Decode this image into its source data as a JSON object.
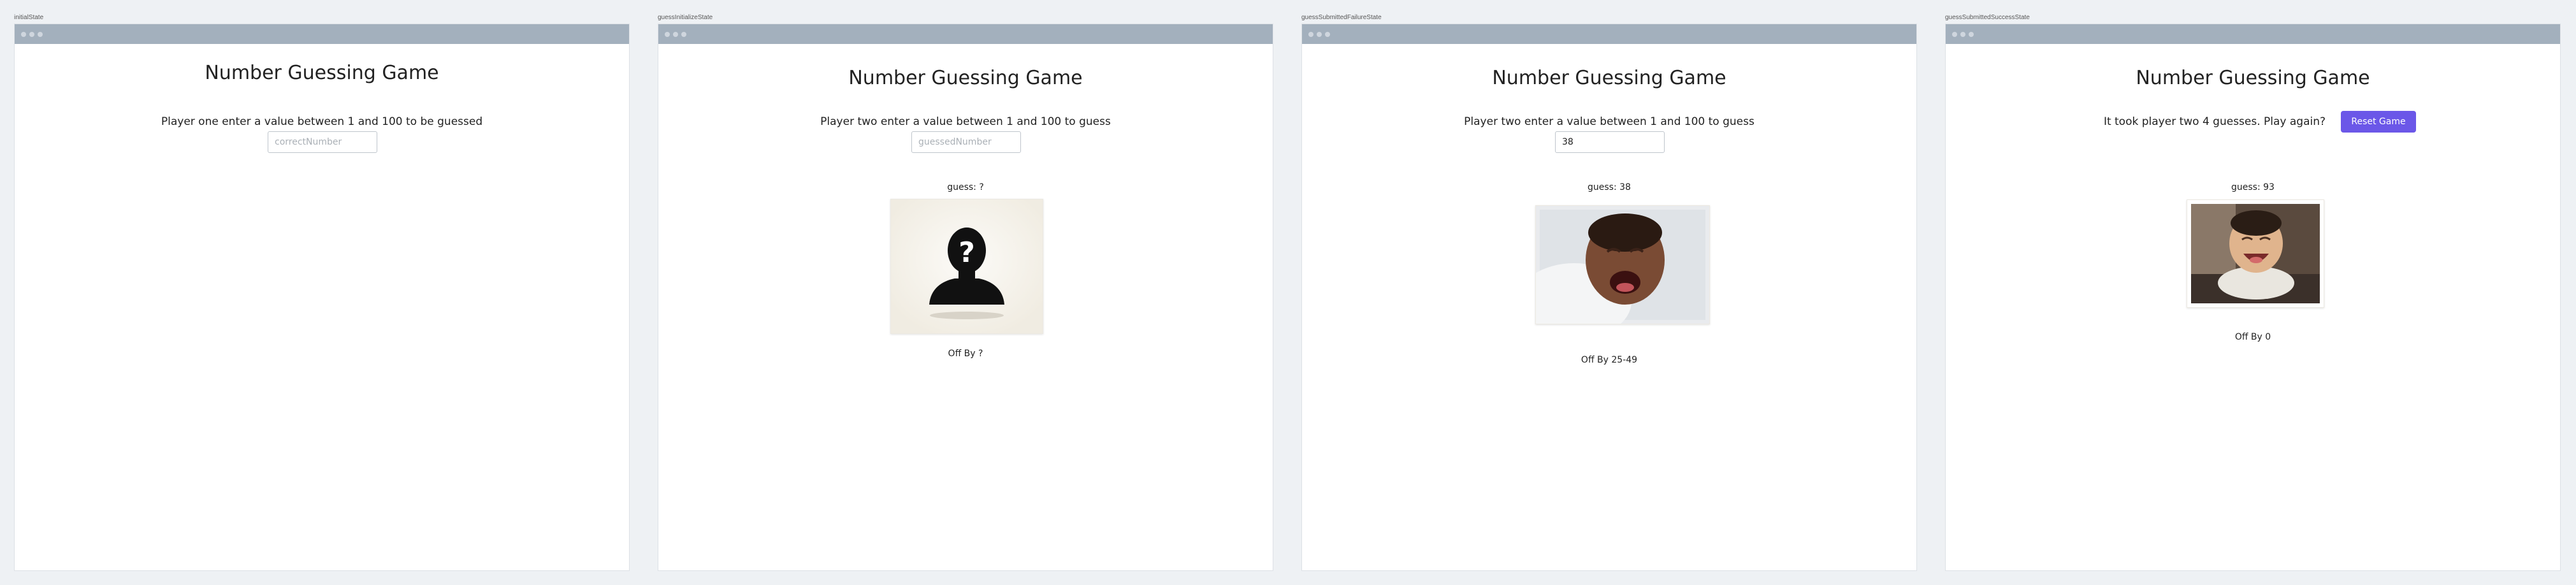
{
  "panels": [
    {
      "label": "initialState",
      "title": "Number Guessing Game",
      "prompt": "Player one enter a value between 1 and 100 to be guessed",
      "input": {
        "value": "",
        "placeholder": "correctNumber"
      }
    },
    {
      "label": "guessInitializeState",
      "title": "Number Guessing Game",
      "prompt": "Player two enter a value between 1 and 100 to guess",
      "input": {
        "value": "",
        "placeholder": "guessedNumber"
      },
      "guess": "guess: ?",
      "image": "mystery-silhouette",
      "off_by": "Off By ?"
    },
    {
      "label": "guessSubmittedFailureState",
      "title": "Number Guessing Game",
      "prompt": "Player two enter a value between 1 and 100 to guess",
      "input": {
        "value": "38",
        "placeholder": "guessedNumber"
      },
      "guess": "guess: 38",
      "image": "crying-baby",
      "off_by": "Off By 25-49"
    },
    {
      "label": "guessSubmittedSuccessState",
      "title": "Number Guessing Game",
      "message": "It took player two 4 guesses. Play again?",
      "reset_label": "Reset Game",
      "guess": "guess: 93",
      "image": "happy-baby",
      "off_by": "Off By 0"
    }
  ],
  "colors": {
    "page_background": "#eef1f4",
    "titlebar": "#a3b0bd",
    "button_accent": "#6b57e8"
  }
}
